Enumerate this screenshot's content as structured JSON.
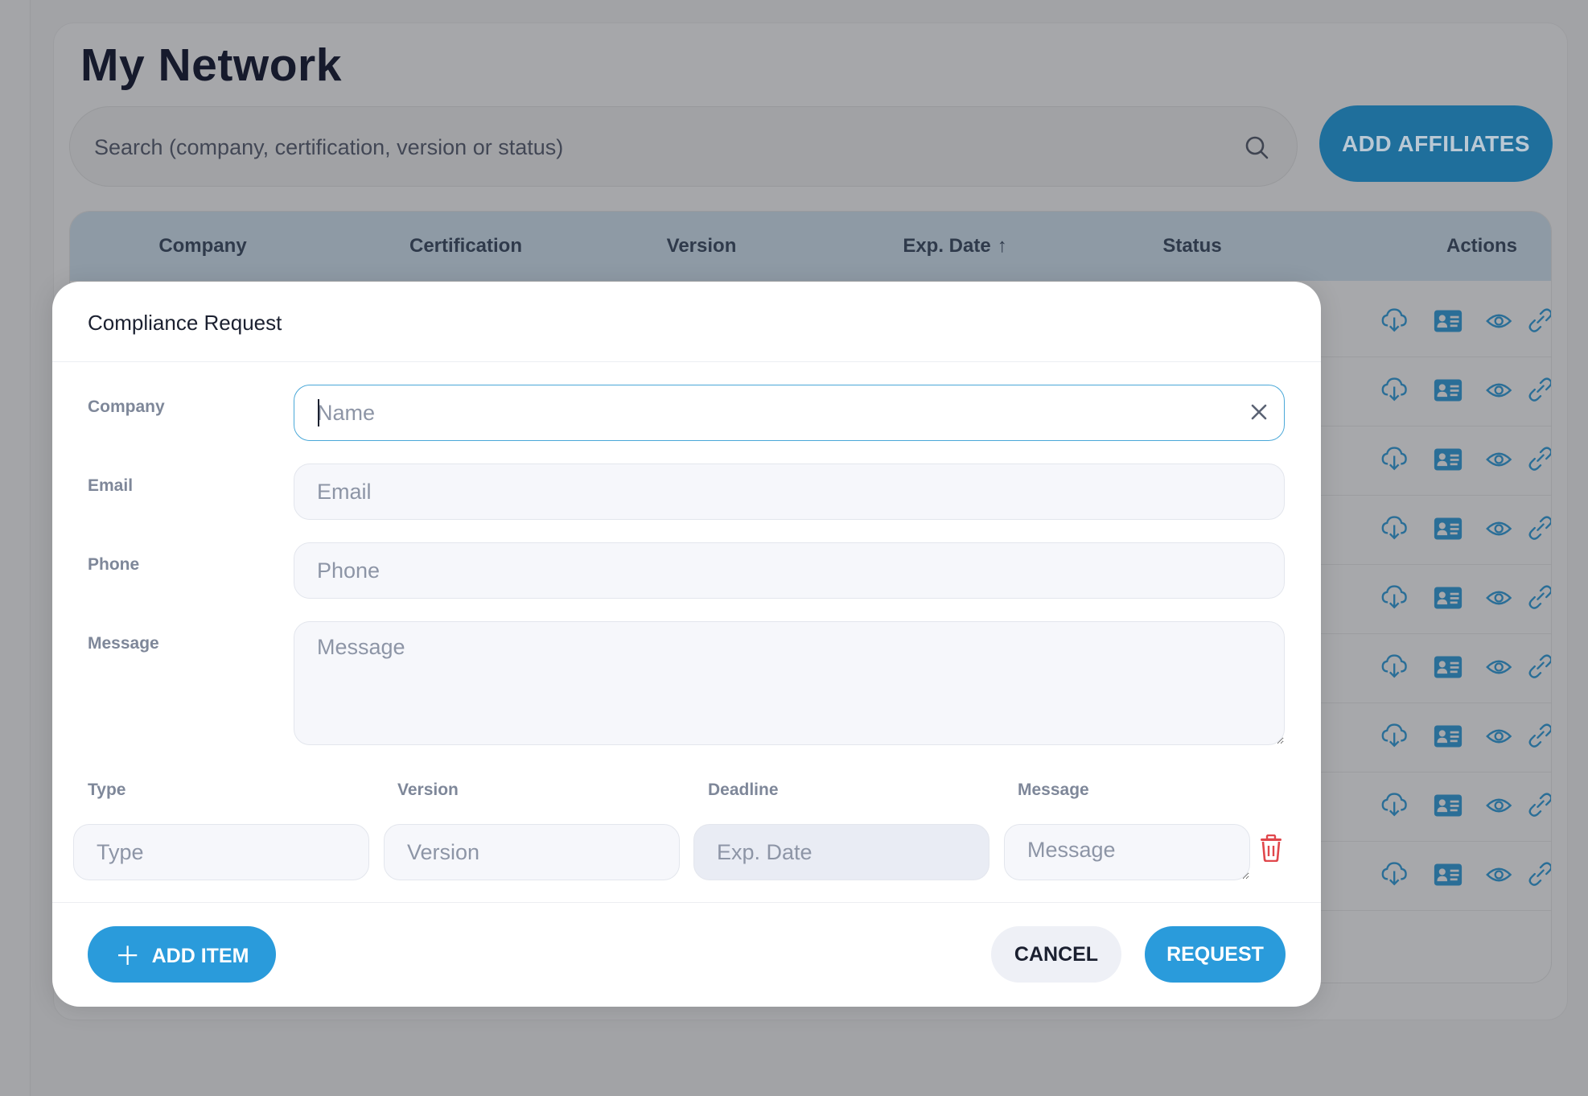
{
  "page": {
    "title": "My Network",
    "search_placeholder": "Search (company, certification, version or status)",
    "add_affiliates_label": "ADD AFFILIATES"
  },
  "table": {
    "columns": [
      "Company",
      "Certification",
      "Version",
      "Exp. Date",
      "Status",
      "Actions"
    ],
    "sort_indicator": "↑",
    "row_count": 9,
    "row_action_icons": [
      "cloud-download-icon",
      "contact-card-icon",
      "eye-icon",
      "link-icon"
    ]
  },
  "modal": {
    "title": "Compliance Request",
    "fields": {
      "company": {
        "label": "Company",
        "placeholder": "Name"
      },
      "email": {
        "label": "Email",
        "placeholder": "Email"
      },
      "phone": {
        "label": "Phone",
        "placeholder": "Phone"
      },
      "message": {
        "label": "Message",
        "placeholder": "Message"
      }
    },
    "item_columns": {
      "type": {
        "label": "Type",
        "placeholder": "Type"
      },
      "version": {
        "label": "Version",
        "placeholder": "Version"
      },
      "deadline": {
        "label": "Deadline",
        "placeholder": "Exp. Date"
      },
      "message": {
        "label": "Message",
        "placeholder": "Message"
      }
    },
    "buttons": {
      "add_item": "ADD ITEM",
      "cancel": "CANCEL",
      "request": "REQUEST"
    }
  },
  "colors": {
    "accent": "#2a9bdb",
    "danger": "#e0474c",
    "overlay_header": "#8e9aa5"
  }
}
